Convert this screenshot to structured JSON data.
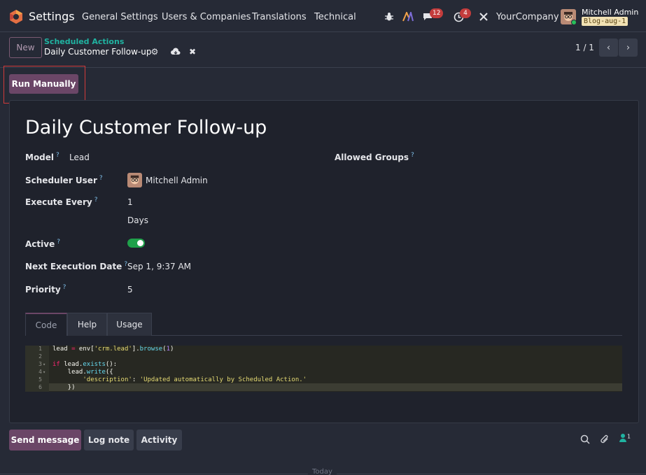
{
  "navbar": {
    "app_name": "Settings",
    "menu": [
      "General Settings",
      "Users & Companies",
      "Translations",
      "Technical"
    ],
    "messages_count": "12",
    "activities_count": "4",
    "company": "YourCompany",
    "user_name": "Mitchell Admin",
    "database": "Blog-aug-1"
  },
  "control_panel": {
    "new_label": "New",
    "breadcrumb_parent": "Scheduled Actions",
    "breadcrumb_current": "Daily Customer Follow-up",
    "pager": "1 / 1"
  },
  "status_bar": {
    "run_manually_label": "Run Manually"
  },
  "form": {
    "title": "Daily Customer Follow-up",
    "fields": {
      "model_label": "Model",
      "model_value": "Lead",
      "allowed_groups_label": "Allowed Groups",
      "scheduler_user_label": "Scheduler User",
      "scheduler_user_value": "Mitchell Admin",
      "execute_every_label": "Execute Every",
      "interval_number": "1",
      "interval_type": "Days",
      "active_label": "Active",
      "active_value": true,
      "next_execution_label": "Next Execution Date",
      "next_execution_value": "Sep 1, 9:37 AM",
      "priority_label": "Priority",
      "priority_value": "5"
    },
    "help_mark": "?",
    "tabs": [
      "Code",
      "Help",
      "Usage"
    ],
    "active_tab": "Code",
    "code_lines": [
      "lead = env['crm.lead'].browse(1)",
      "",
      "if lead.exists():",
      "    lead.write({",
      "        'description': 'Updated automatically by Scheduled Action.'",
      "    })"
    ],
    "line_numbers": [
      "1",
      "2",
      "3",
      "4",
      "5",
      "6"
    ]
  },
  "chatter": {
    "send_message_label": "Send message",
    "log_note_label": "Log note",
    "activity_label": "Activity",
    "followers_count": "1",
    "today_label": "Today"
  },
  "colors": {
    "primary": "#6b4667",
    "accent_teal": "#20b3a1",
    "background": "#262a36",
    "sheet": "#1f222c",
    "toggle_on": "#1fa04a",
    "badge": "#c33c3c"
  },
  "icons": [
    "odoo-logo-icon",
    "bug-icon",
    "studio-icon",
    "chat-icon",
    "clock-icon",
    "tools-icon",
    "gear-icon",
    "cloud-save-icon",
    "discard-icon",
    "chevron-left-icon",
    "chevron-right-icon",
    "search-icon",
    "paperclip-icon",
    "followers-icon"
  ]
}
